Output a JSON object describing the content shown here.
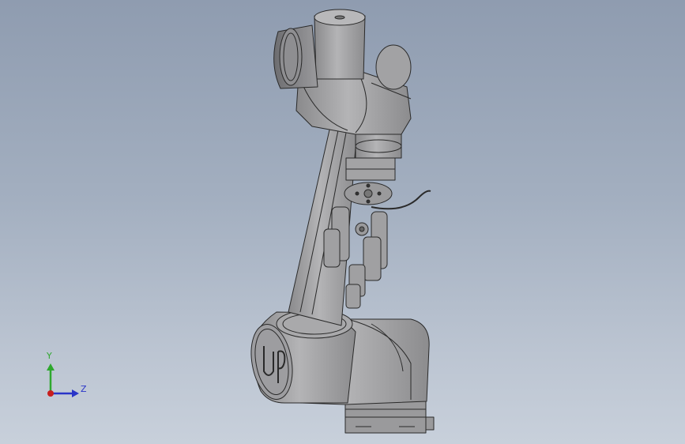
{
  "view": {
    "background_top": "#8f9cb0",
    "background_bottom": "#c8d0db"
  },
  "model": {
    "type": "robot-arm",
    "logo_text": "UR",
    "body_color": "#a7a7a9",
    "edge_color": "#2a2a2a"
  },
  "triad": {
    "y_label": "Y",
    "z_label": "Z",
    "y_color": "#2ea82e",
    "z_color": "#2a35c8",
    "x_color": "#c81e1e"
  }
}
